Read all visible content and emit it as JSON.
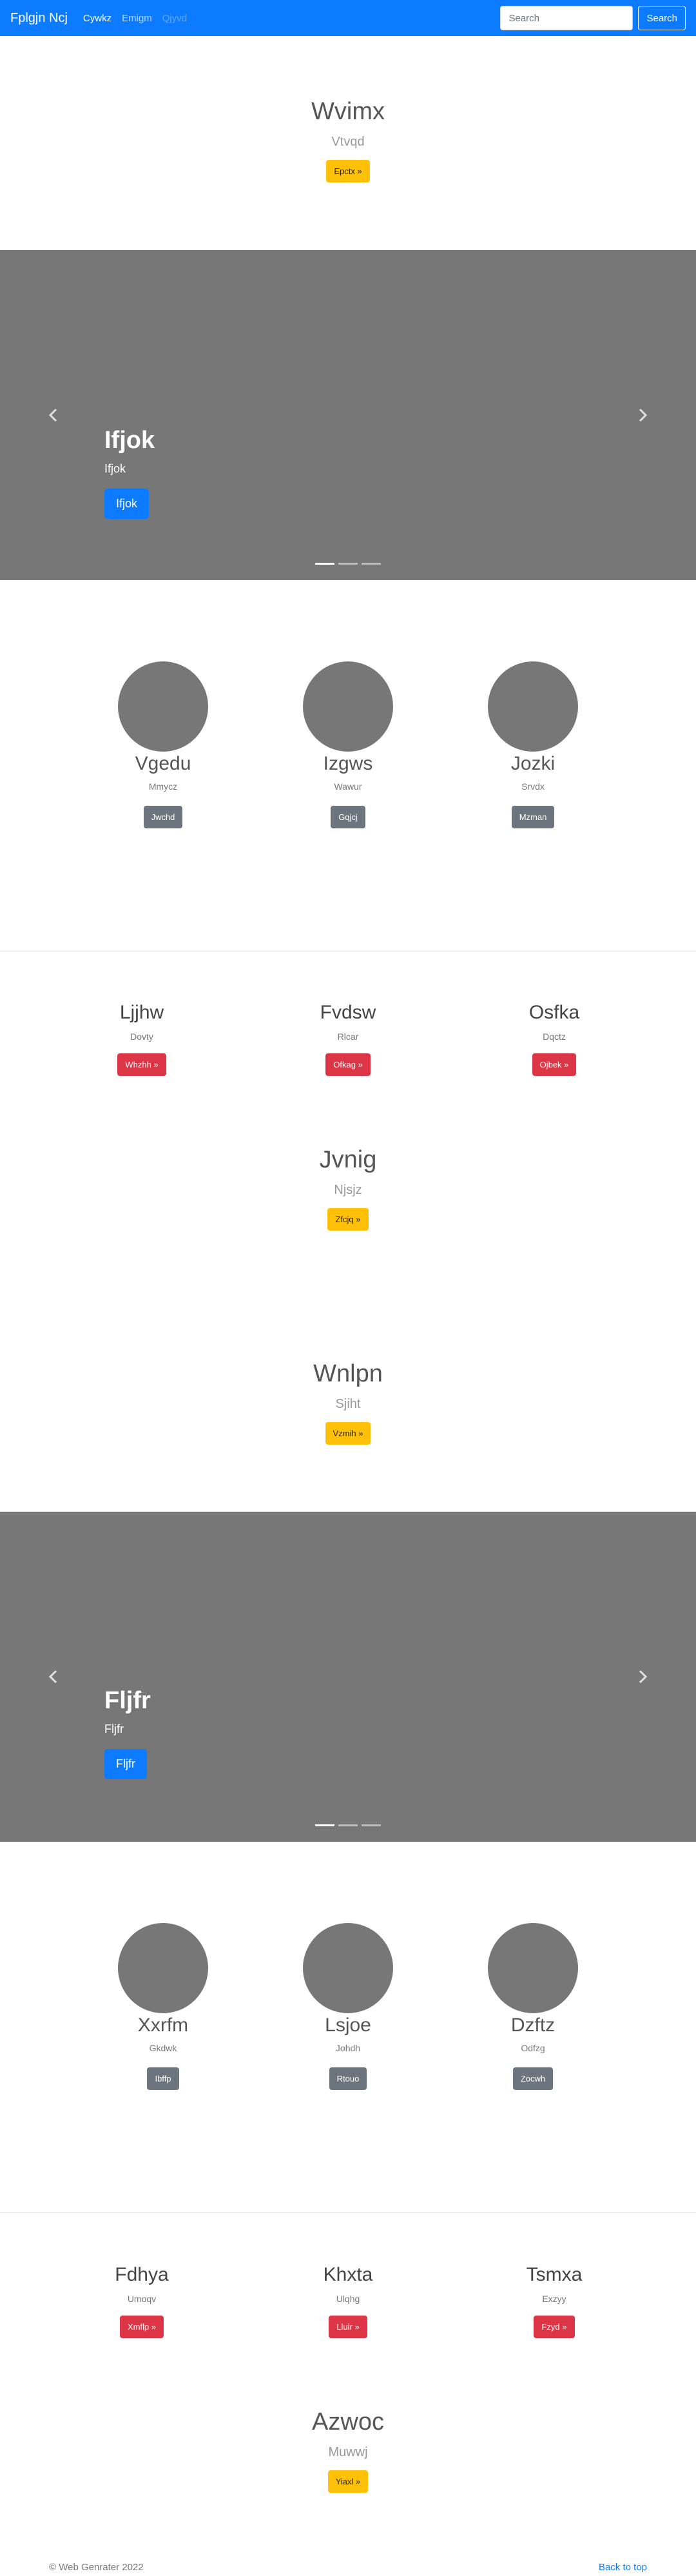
{
  "navbar": {
    "brand": "Fplgjn Ncj",
    "links": [
      {
        "label": "Cywkz",
        "state": "active"
      },
      {
        "label": "Emigm",
        "state": "normal"
      },
      {
        "label": "Qjyvd",
        "state": "disabled"
      }
    ],
    "search": {
      "placeholder": "Search",
      "button": "Search"
    }
  },
  "hero1": {
    "title": "Wvimx",
    "subtitle": "Vtvqd",
    "button": "Epctx »"
  },
  "carousel1": {
    "title": "Ifjok",
    "text": "Ifjok",
    "button": "Ifjok"
  },
  "profiles1": [
    {
      "name": "Vgedu",
      "sub": "Mmycz",
      "button": "Jwchd"
    },
    {
      "name": "Izgws",
      "sub": "Wawur",
      "button": "Gqjcj"
    },
    {
      "name": "Jozki",
      "sub": "Srvdx",
      "button": "Mzman"
    }
  ],
  "features1": [
    {
      "title": "Ljjhw",
      "sub": "Dovty",
      "button": "Whzhh »"
    },
    {
      "title": "Fvdsw",
      "sub": "Rlcar",
      "button": "Ofkag »"
    },
    {
      "title": "Osfka",
      "sub": "Dqctz",
      "button": "Ojbek »"
    }
  ],
  "hero2": {
    "title": "Jvnig",
    "subtitle": "Njsjz",
    "button": "Zfcjq »"
  },
  "hero3": {
    "title": "Wnlpn",
    "subtitle": "Sjiht",
    "button": "Vzmih »"
  },
  "carousel2": {
    "title": "Fljfr",
    "text": "Fljfr",
    "button": "Fljfr"
  },
  "profiles2": [
    {
      "name": "Xxrfm",
      "sub": "Gkdwk",
      "button": "Ibffp"
    },
    {
      "name": "Lsjoe",
      "sub": "Johdh",
      "button": "Rtouo"
    },
    {
      "name": "Dzftz",
      "sub": "Odfzg",
      "button": "Zocwh"
    }
  ],
  "features2": [
    {
      "title": "Fdhya",
      "sub": "Umoqv",
      "button": "Xmflp »"
    },
    {
      "title": "Khxta",
      "sub": "Ulqhg",
      "button": "Lluir »"
    },
    {
      "title": "Tsmxa",
      "sub": "Exzyy",
      "button": "Fzyd »"
    }
  ],
  "hero4": {
    "title": "Azwoc",
    "subtitle": "Muwwj",
    "button": "Yiaxl »"
  },
  "footer": {
    "copyright": "© Web Genrater 2022",
    "back_to_top": "Back to top"
  },
  "colors": {
    "primary": "#0d7bff",
    "warning": "#ffc107",
    "danger": "#dc3545",
    "secondary": "#6c757d",
    "placeholder": "#777777"
  }
}
